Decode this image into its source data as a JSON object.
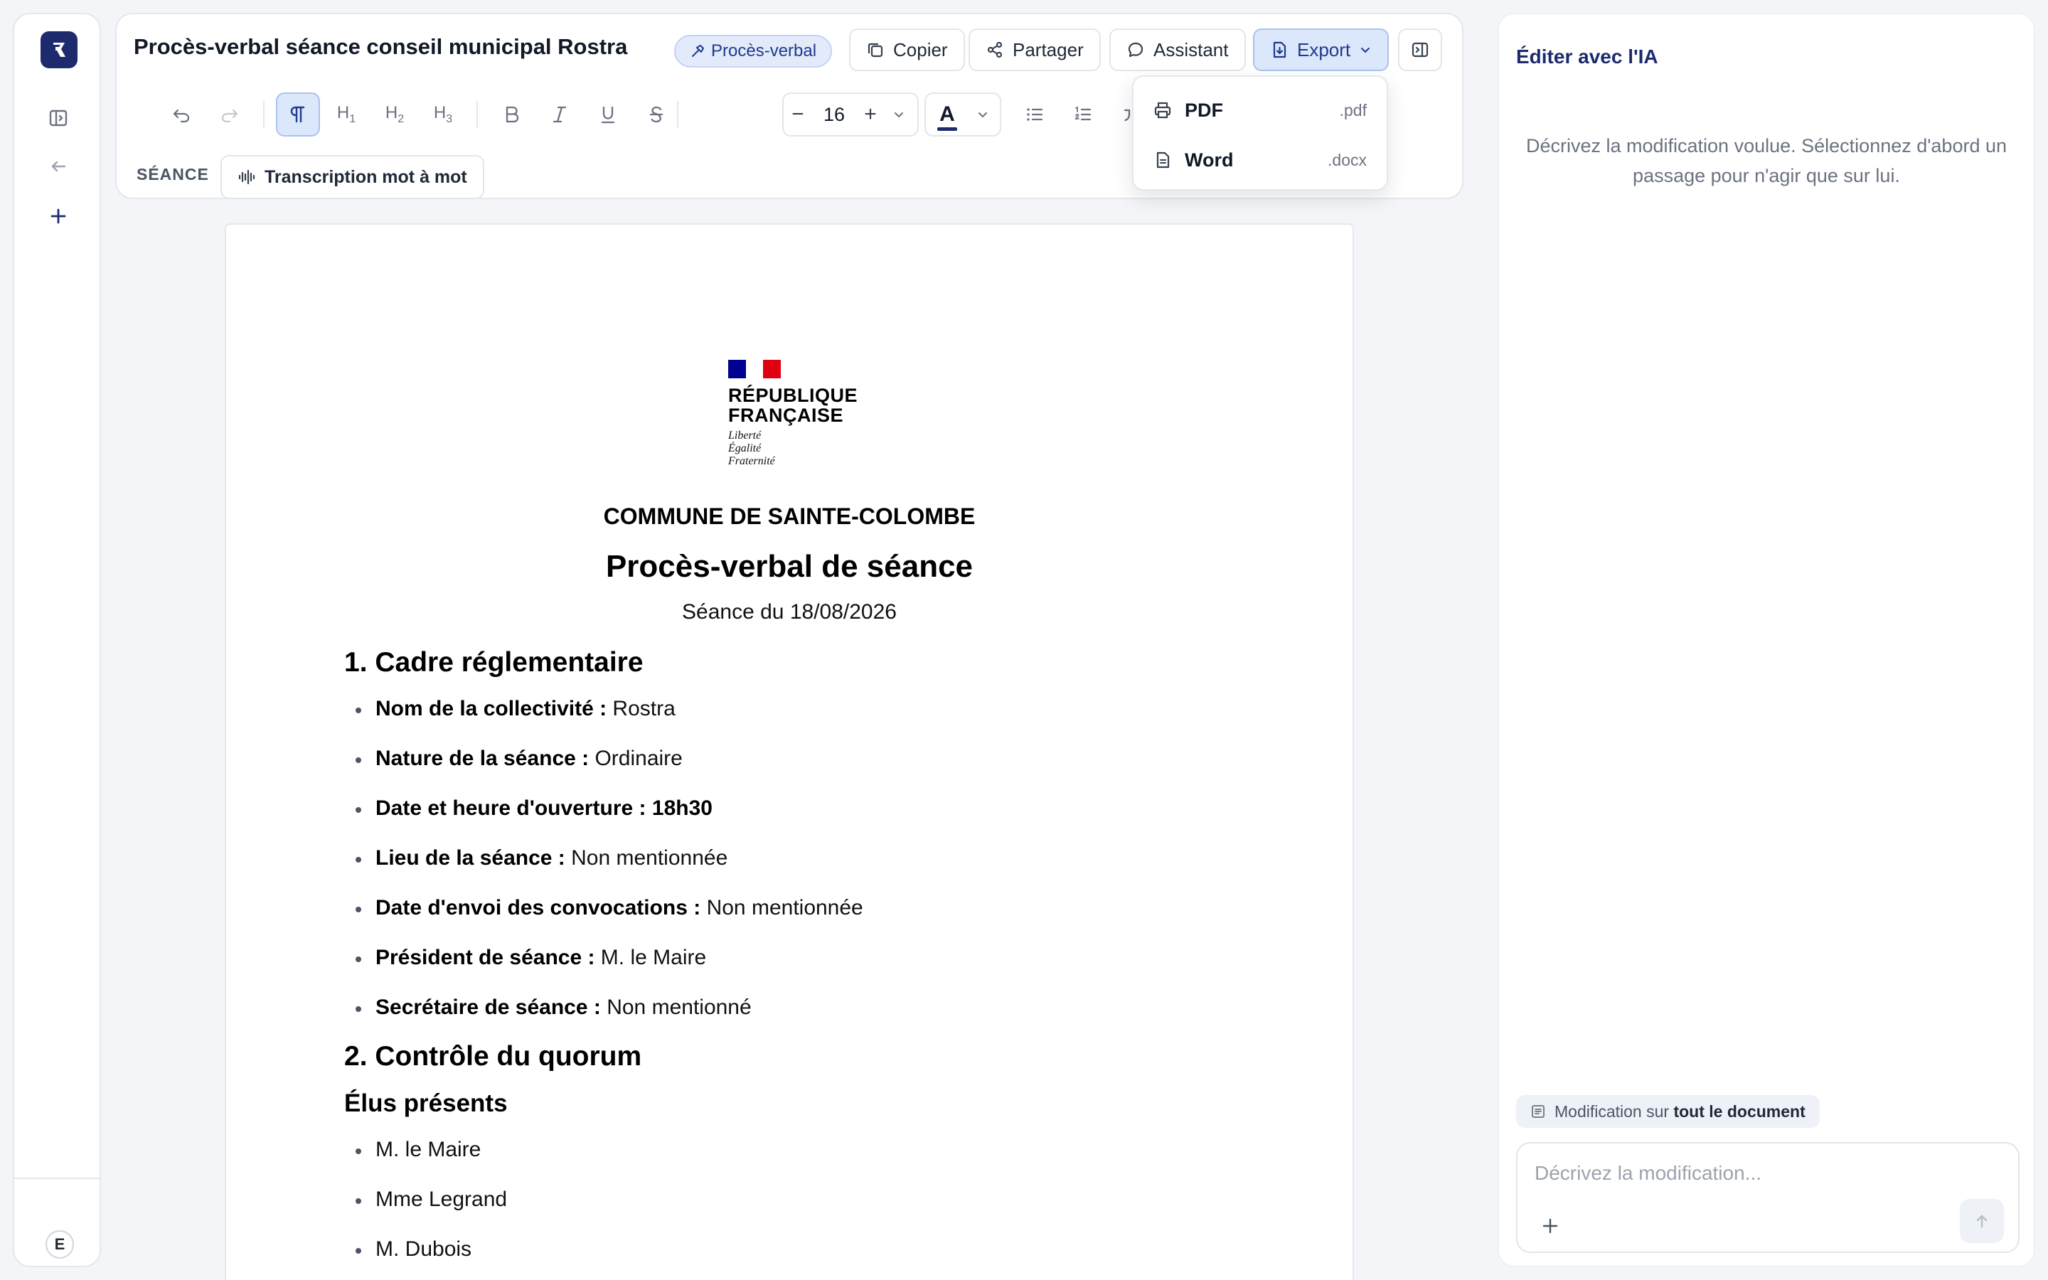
{
  "rail": {
    "avatar_initial": "E"
  },
  "header": {
    "doc_title": "Procès-verbal séance conseil municipal Rostra",
    "doc_type_tag": "Procès-verbal",
    "buttons": {
      "copy": "Copier",
      "share": "Partager",
      "assistant": "Assistant",
      "export": "Export"
    }
  },
  "toolbar": {
    "heading1": "H",
    "heading2": "H",
    "heading3": "H",
    "heading1_level": "1",
    "heading2_level": "2",
    "heading3_level": "3",
    "font_size": "16",
    "font_decrease": "−",
    "font_increase": "+",
    "text_color_glyph": "A"
  },
  "section": {
    "label": "SÉANCE",
    "transcript_button": "Transcription mot à mot"
  },
  "export_menu": {
    "items": [
      {
        "label": "PDF",
        "ext": ".pdf"
      },
      {
        "label": "Word",
        "ext": ".docx"
      }
    ]
  },
  "document": {
    "marianne": {
      "line1": "RÉPUBLIQUE",
      "line2": "FRANÇAISE",
      "devise1": "Liberté",
      "devise2": "Égalité",
      "devise3": "Fraternité",
      "flag_colors": [
        "#000091",
        "#ffffff",
        "#e1000f"
      ]
    },
    "commune": "COMMUNE DE SAINTE-COLOMBE",
    "title": "Procès-verbal de séance",
    "date_line": "Séance du 18/08/2026",
    "section1_title": "1. Cadre réglementaire",
    "section1_items": [
      {
        "label": "Nom de la collectivité :",
        "value": " Rostra"
      },
      {
        "label": "Nature de la séance :",
        "value": " Ordinaire"
      },
      {
        "label": "Date et heure d'ouverture : 18h30",
        "value": ""
      },
      {
        "label": "Lieu de la séance :",
        "value": " Non mentionnée"
      },
      {
        "label": "Date d'envoi des convocations :",
        "value": " Non mentionnée"
      },
      {
        "label": "Président de séance :",
        "value": " M. le Maire"
      },
      {
        "label": "Secrétaire de séance :",
        "value": " Non mentionné"
      }
    ],
    "section2_title": "2. Contrôle du quorum",
    "present_title": "Élus présents",
    "present_items": [
      "M. le Maire",
      "Mme Legrand",
      "M. Dubois"
    ]
  },
  "ai_panel": {
    "title": "Éditer avec l'IA",
    "hint": "Décrivez la modification voulue. Sélectionnez d'abord un passage pour n'agir que sur lui.",
    "scope_prefix": "Modification sur",
    "scope_target": "tout le document",
    "input_placeholder": "Décrivez la modification..."
  },
  "colors": {
    "brand": "#1e2a6e",
    "accent_bg": "#dbe7fb",
    "accent_border": "#aac2ee"
  }
}
